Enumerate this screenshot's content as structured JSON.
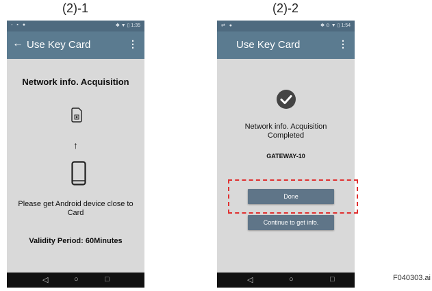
{
  "left_screen": {
    "caption": "(2)-1",
    "status_right": "✱ ▼ ▯ 1:35",
    "title": "Use Key Card",
    "heading": "Network info. Acquisition",
    "instruction_line1": "Please get Android device close to",
    "instruction_line2": "Card",
    "validity": "Validity Period: 60Minutes",
    "nav": {
      "back": "◁",
      "home": "○",
      "recent": "□"
    }
  },
  "right_screen": {
    "caption": "(2)-2",
    "status_right": "✱ ⊙ ▼ ▯ 1:54",
    "title": "Use Key Card",
    "message_line1": "Network info. Acquisition",
    "message_line2": "Completed",
    "gateway": "GATEWAY-10",
    "done_label": "Done",
    "continue_label": "Continue to get info.",
    "nav": {
      "back": "◁",
      "home": "○",
      "recent": "□"
    }
  },
  "figure_id": "F040303.ai",
  "colors": {
    "appbar": "#5b7b90",
    "statusbar": "#4e6a7f",
    "highlight": "#e03030"
  }
}
